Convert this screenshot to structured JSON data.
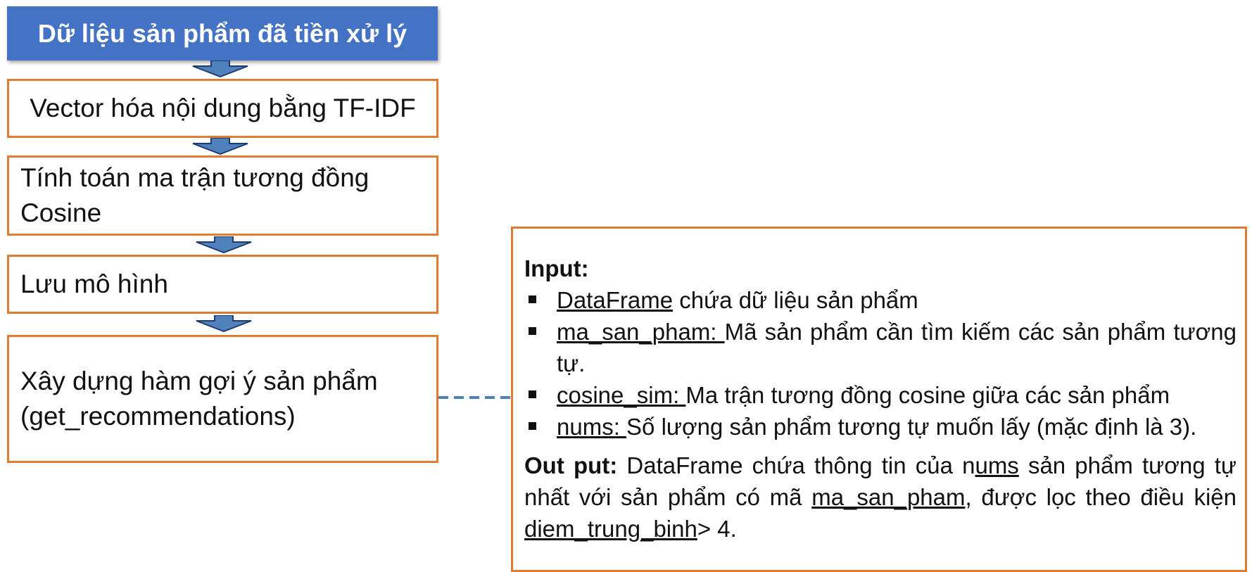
{
  "flow": {
    "header": "Dữ liệu sản phẩm đã tiền xử lý",
    "steps": [
      {
        "line1": "Vector hóa nội dung bằng TF-IDF",
        "line2": ""
      },
      {
        "line1": "Tính toán ma trận tương đồng",
        "line2": "Cosine"
      },
      {
        "line1": "Lưu mô hình",
        "line2": ""
      },
      {
        "line1": "Xây dựng hàm gợi ý sản phẩm",
        "line2": "(get_recommendations)"
      }
    ]
  },
  "info": {
    "input_title": "Input:",
    "bullets": [
      {
        "term": "DataFrame",
        "desc": " chứa dữ liệu sản phẩm"
      },
      {
        "term": "ma_san_pham: ",
        "desc": "Mã sản phẩm cần tìm kiếm các sản phẩm tương tự."
      },
      {
        "term": "cosine_sim: ",
        "desc": "Ma trận tương đồng cosine giữa các sản phẩm"
      },
      {
        "term": "nums: ",
        "desc": "Số lượng sản phẩm tương tự muốn lấy (mặc định là 3)."
      }
    ],
    "output": {
      "label": "Out put:",
      "text1": " DataFrame chứa thông tin của n",
      "ums": "ums",
      "text2": " sản phẩm tương tự nhất với sản phẩm có mã ",
      "code": "ma_san_pham",
      "text3": ", được lọc theo điều kiện ",
      "field": "diem_trung_binh",
      "text4": "> 4."
    }
  },
  "colors": {
    "header_fill": "#4472c4",
    "box_border": "#e07b32",
    "arrow_fill": "#4f81bd",
    "arrow_stroke": "#1f3c6e",
    "connector": "#4f81bd"
  }
}
